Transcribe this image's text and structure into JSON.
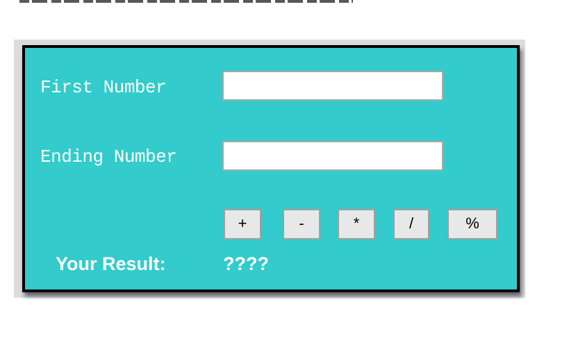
{
  "form": {
    "first_label": "First Number",
    "first_value": "",
    "ending_label": "Ending Number",
    "ending_value": ""
  },
  "operators": {
    "plus": "+",
    "minus": "-",
    "multiply": "*",
    "divide": "/",
    "modulo": "%"
  },
  "result": {
    "label": "Your Result:",
    "value": "????"
  },
  "colors": {
    "panel_bg": "#33cbcb",
    "panel_border": "#000000",
    "label_text": "#ffffff",
    "button_bg": "#e8e8e8"
  }
}
